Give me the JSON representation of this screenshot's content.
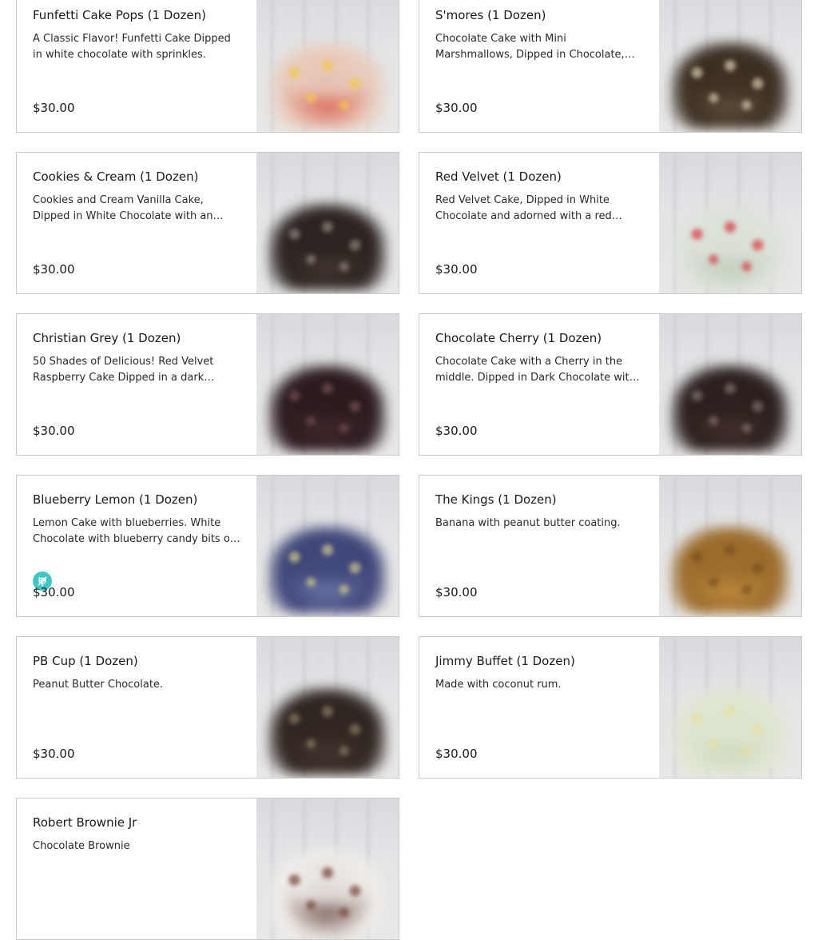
{
  "products": [
    {
      "name": "Funfetti Cake Pops (1 Dozen)",
      "description": "A Classic Flavor! Funfetti Cake Dipped in white chocolate with sprinkles.",
      "price": "$30.00",
      "badge": false,
      "image": {
        "base": "#e8cfc0",
        "accent": "#d94c3a",
        "dots": "#f2c94c"
      }
    },
    {
      "name": "S'mores (1 Dozen)",
      "description": "Chocolate Cake with Mini Marshmallows, Dipped in Chocolate, rolled in Mini Marshmallows.",
      "price": "$30.00",
      "badge": false,
      "image": {
        "base": "#3a2e22",
        "accent": "#6a5a40",
        "dots": "#cfc3a5"
      }
    },
    {
      "name": "Cookies & Cream (1 Dozen)",
      "description": "Cookies and Cream Vanilla Cake, Dipped in White Chocolate with an Oreo Cookie crumble.",
      "price": "$30.00",
      "badge": false,
      "image": {
        "base": "#2b2320",
        "accent": "#4a3c35",
        "dots": "#8a7d75"
      }
    },
    {
      "name": "Red Velvet (1 Dozen)",
      "description": "Red Velvet Cake, Dipped in White Chocolate and adorned with a red candy heart.",
      "price": "$30.00",
      "badge": false,
      "image": {
        "base": "#dde3da",
        "accent": "#b6c7b0",
        "dots": "#d9434b"
      }
    },
    {
      "name": "Christian Grey (1 Dozen)",
      "description": "50 Shades of Delicious! Red Velvet Raspberry Cake Dipped in a dark chocolate shell.",
      "price": "$30.00",
      "badge": false,
      "image": {
        "base": "#2a1a1c",
        "accent": "#4b2e34",
        "dots": "#6e4a50"
      }
    },
    {
      "name": "Chocolate Cherry (1 Dozen)",
      "description": "Chocolate Cake with a Cherry in the middle. Dipped in Dark Chocolate with drizzle.",
      "price": "$30.00",
      "badge": false,
      "image": {
        "base": "#2a1f1d",
        "accent": "#4a3833",
        "dots": "#7a6a62"
      }
    },
    {
      "name": "Blueberry Lemon (1 Dozen)",
      "description": "Lemon Cake with blueberries. White Chocolate with blueberry candy bits on top.",
      "price": "$30.00",
      "badge": true,
      "badge_icon": "leaf-icon",
      "badge_color": "#3cc8c4",
      "image": {
        "base": "#3d4476",
        "accent": "#7c86b5",
        "dots": "#c9c48a"
      }
    },
    {
      "name": "The Kings (1 Dozen)",
      "description": "Banana with peanut butter coating.",
      "price": "$30.00",
      "badge": false,
      "image": {
        "base": "#9a6a2a",
        "accent": "#c79445",
        "dots": "#7b5420"
      }
    },
    {
      "name": "PB Cup (1 Dozen)",
      "description": "Peanut Butter Chocolate.",
      "price": "$30.00",
      "badge": false,
      "image": {
        "base": "#2f2520",
        "accent": "#4b3b33",
        "dots": "#857560"
      }
    },
    {
      "name": "Jimmy Buffet (1 Dozen)",
      "description": "Made with coconut rum.",
      "price": "$30.00",
      "badge": false,
      "image": {
        "base": "#dfe6d2",
        "accent": "#c9d7b5",
        "dots": "#e8e0a0"
      }
    },
    {
      "name": "Robert Brownie Jr",
      "description": "Chocolate Brownie",
      "price": "",
      "badge": false,
      "image": {
        "base": "#f1eeea",
        "accent": "#5a3630",
        "dots": "#7a4a40"
      }
    }
  ]
}
